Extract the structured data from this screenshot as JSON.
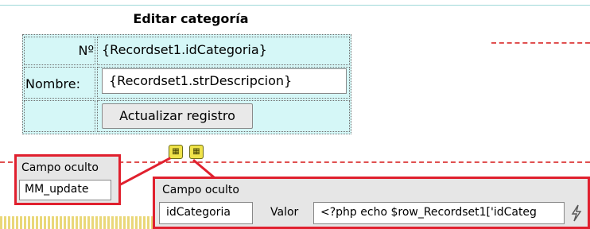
{
  "form": {
    "title": "Editar categoría",
    "rows": [
      {
        "label": "Nº",
        "value": "{Recordset1.idCategoria}"
      },
      {
        "label": "Nombre:",
        "value": "{Recordset1.strDescripcion}"
      }
    ],
    "submit_label": "Actualizar registro"
  },
  "hidden_field_1": {
    "title": "Campo oculto",
    "name": "MM_update"
  },
  "hidden_field_2": {
    "title": "Campo oculto",
    "name": "idCategoria",
    "value_label": "Valor",
    "value": "<?php echo $row_Recordset1['idCateg"
  },
  "colors": {
    "table_bg": "#d5f7f7",
    "highlight": "#e0202e",
    "panel_bg": "#e6e6e6"
  },
  "icons": {
    "hidden_field_markers": "hidden-field-icon",
    "bind": "lightning-icon"
  }
}
